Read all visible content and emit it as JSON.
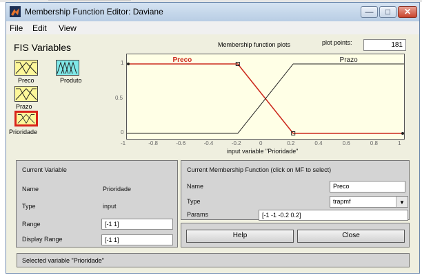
{
  "window": {
    "title": "Membership Function Editor: Daviane",
    "controls": {
      "minimize": "—",
      "maximize": "□",
      "close": "✕"
    }
  },
  "menu": [
    "File",
    "Edit",
    "View"
  ],
  "fis": {
    "heading": "FIS Variables",
    "variables": [
      {
        "name": "Preco",
        "kind": "input",
        "selected": false
      },
      {
        "name": "Produto",
        "kind": "output",
        "selected": false
      },
      {
        "name": "Prazo",
        "kind": "input",
        "selected": false
      },
      {
        "name": "Prioridade",
        "kind": "input",
        "selected": true
      }
    ]
  },
  "plot_header": {
    "title": "Membership function plots",
    "points_label": "plot points:",
    "points_value": "181"
  },
  "chart_data": {
    "type": "line",
    "xlabel": "input variable \"Prioridade\"",
    "xlim": [
      -1,
      1
    ],
    "ylim": [
      0,
      1
    ],
    "x_ticks": [
      "-1",
      "-0.8",
      "-0.6",
      "-0.4",
      "-0.2",
      "0",
      "0.2",
      "0.4",
      "0.6",
      "0.8",
      "1"
    ],
    "y_ticks": [
      "0",
      "0.5",
      "1"
    ],
    "series": [
      {
        "name": "Preco",
        "color": "#cc2a1d",
        "selected": true,
        "x": [
          -1,
          -1,
          -0.2,
          0.2,
          1
        ],
        "y": [
          1,
          1,
          1,
          0,
          0
        ]
      },
      {
        "name": "Prazo",
        "color": "#222222",
        "selected": false,
        "x": [
          -1,
          -0.2,
          0.2,
          1,
          1
        ],
        "y": [
          0,
          0,
          1,
          1,
          1
        ]
      }
    ]
  },
  "current_variable": {
    "heading": "Current Variable",
    "name_label": "Name",
    "name_value": "Prioridade",
    "type_label": "Type",
    "type_value": "input",
    "range_label": "Range",
    "range_value": "[-1 1]",
    "display_range_label": "Display Range",
    "display_range_value": "[-1 1]"
  },
  "current_mf": {
    "heading": "Current Membership Function (click on MF to select)",
    "name_label": "Name",
    "name_value": "Preco",
    "type_label": "Type",
    "type_value": "trapmf",
    "params_label": "Params",
    "params_value": "[-1 -1 -0.2 0.2]"
  },
  "buttons": {
    "help": "Help",
    "close": "Close"
  },
  "status": "Selected variable \"Prioridade\"",
  "colors": {
    "selected_mf": "#cc2a1d",
    "plot_bg": "#ffffe6",
    "input_var": "#fdf79a",
    "output_var": "#7fe8e8"
  }
}
